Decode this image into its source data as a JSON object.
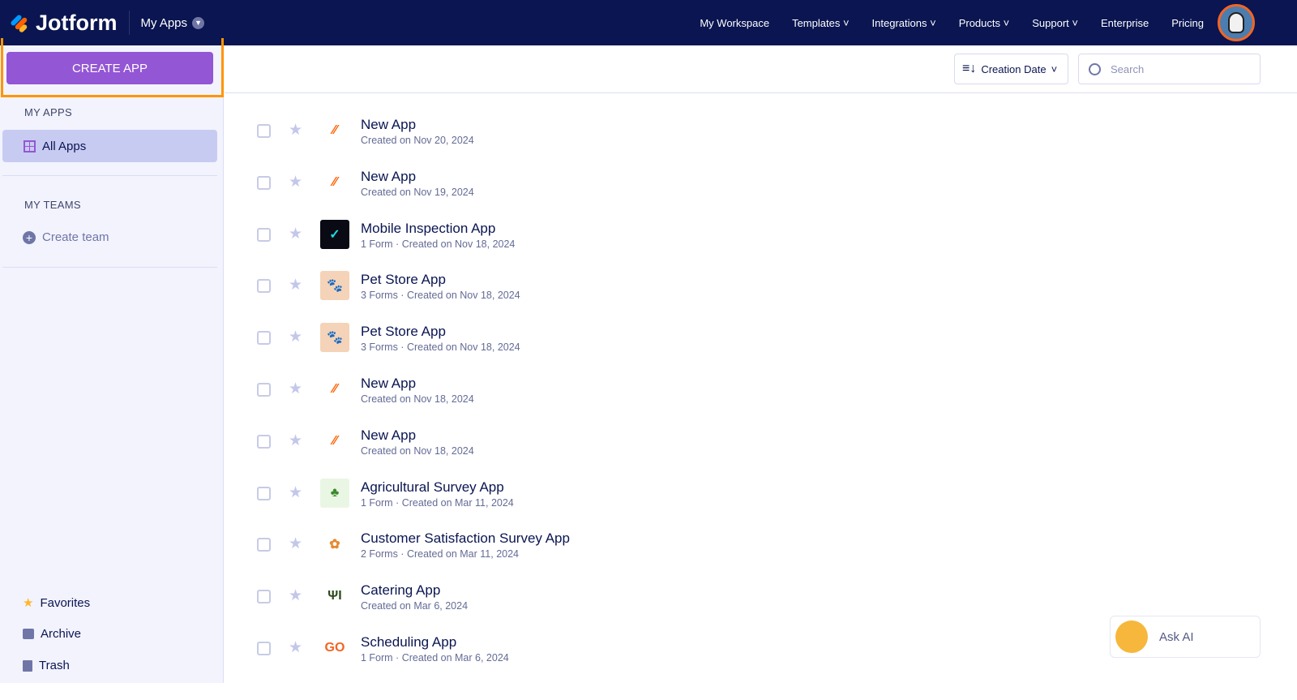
{
  "header": {
    "brand": "Jotform",
    "section": "My Apps",
    "nav": [
      "My Workspace",
      "Templates",
      "Integrations",
      "Products",
      "Support",
      "Enterprise",
      "Pricing"
    ]
  },
  "sidebar": {
    "create_label": "CREATE APP",
    "my_apps_heading": "MY APPS",
    "all_apps": "All Apps",
    "my_teams_heading": "MY TEAMS",
    "create_team": "Create team",
    "favorites": "Favorites",
    "archive": "Archive",
    "trash": "Trash"
  },
  "toolbar": {
    "sort_label": "Creation Date",
    "search_placeholder": "Search"
  },
  "apps": [
    {
      "title": "New App",
      "meta": "Created on Nov 20, 2024",
      "icon": "jotform-icon"
    },
    {
      "title": "New App",
      "meta": "Created on Nov 19, 2024",
      "icon": "jotform-icon"
    },
    {
      "title": "Mobile Inspection App",
      "meta": "1 Form · Created on Nov 18, 2024",
      "icon": "checkmark-icon"
    },
    {
      "title": "Pet Store App",
      "meta": "3 Forms · Created on Nov 18, 2024",
      "icon": "pet-icon"
    },
    {
      "title": "Pet Store App",
      "meta": "3 Forms · Created on Nov 18, 2024",
      "icon": "pet-icon"
    },
    {
      "title": "New App",
      "meta": "Created on Nov 18, 2024",
      "icon": "jotform-icon"
    },
    {
      "title": "New App",
      "meta": "Created on Nov 18, 2024",
      "icon": "jotform-icon"
    },
    {
      "title": "Agricultural Survey App",
      "meta": "1 Form · Created on Mar 11, 2024",
      "icon": "plant-icon"
    },
    {
      "title": "Customer Satisfaction Survey App",
      "meta": "2 Forms · Created on Mar 11, 2024",
      "icon": "flower-icon"
    },
    {
      "title": "Catering App",
      "meta": "Created on Mar 6, 2024",
      "icon": "cutlery-icon"
    },
    {
      "title": "Scheduling App",
      "meta": "1 Form · Created on Mar 6, 2024",
      "icon": "go-icon"
    }
  ],
  "ask_ai": "Ask AI"
}
